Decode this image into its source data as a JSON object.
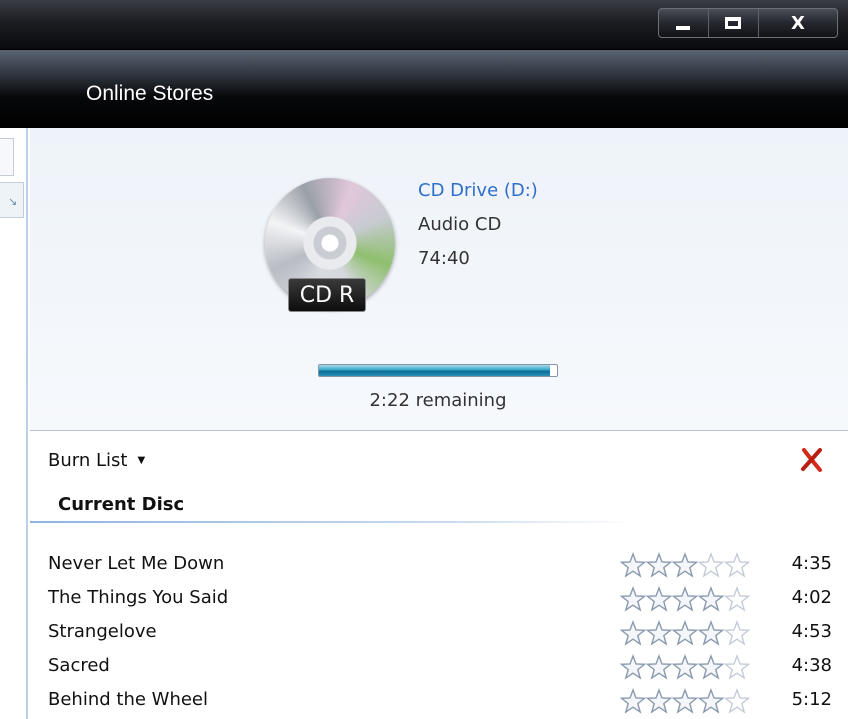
{
  "window": {
    "minimize_glyph": "minimize",
    "maximize_glyph": "maximize",
    "close_glyph": "X"
  },
  "header": {
    "title": "Online Stores"
  },
  "cd": {
    "drive_name": "CD Drive (D:)",
    "disc_type": "Audio CD",
    "total_length": "74:40",
    "disc_label": "CD R",
    "icon": "cd-disc-icon"
  },
  "burn": {
    "progress_fraction": 0.97,
    "remaining_text": "2:22 remaining"
  },
  "list": {
    "title": "Burn List",
    "dropdown_icon": "chevron-down-icon",
    "clear_icon": "red-x-icon",
    "section": "Current Disc",
    "tracks": [
      {
        "title": "Never Let Me Down",
        "rating": 3,
        "max_rating": 5,
        "duration": "4:35"
      },
      {
        "title": "The Things You Said",
        "rating": 4,
        "max_rating": 5,
        "duration": "4:02"
      },
      {
        "title": "Strangelove",
        "rating": 4,
        "max_rating": 5,
        "duration": "4:53"
      },
      {
        "title": "Sacred",
        "rating": 4,
        "max_rating": 5,
        "duration": "4:38"
      },
      {
        "title": "Behind the Wheel",
        "rating": 4,
        "max_rating": 5,
        "duration": "5:12"
      }
    ]
  },
  "colors": {
    "accent": "#2e6fc9",
    "progress": "#1a8fbb",
    "clear": "#d42a1a",
    "star_outline": "#8a9aae"
  }
}
